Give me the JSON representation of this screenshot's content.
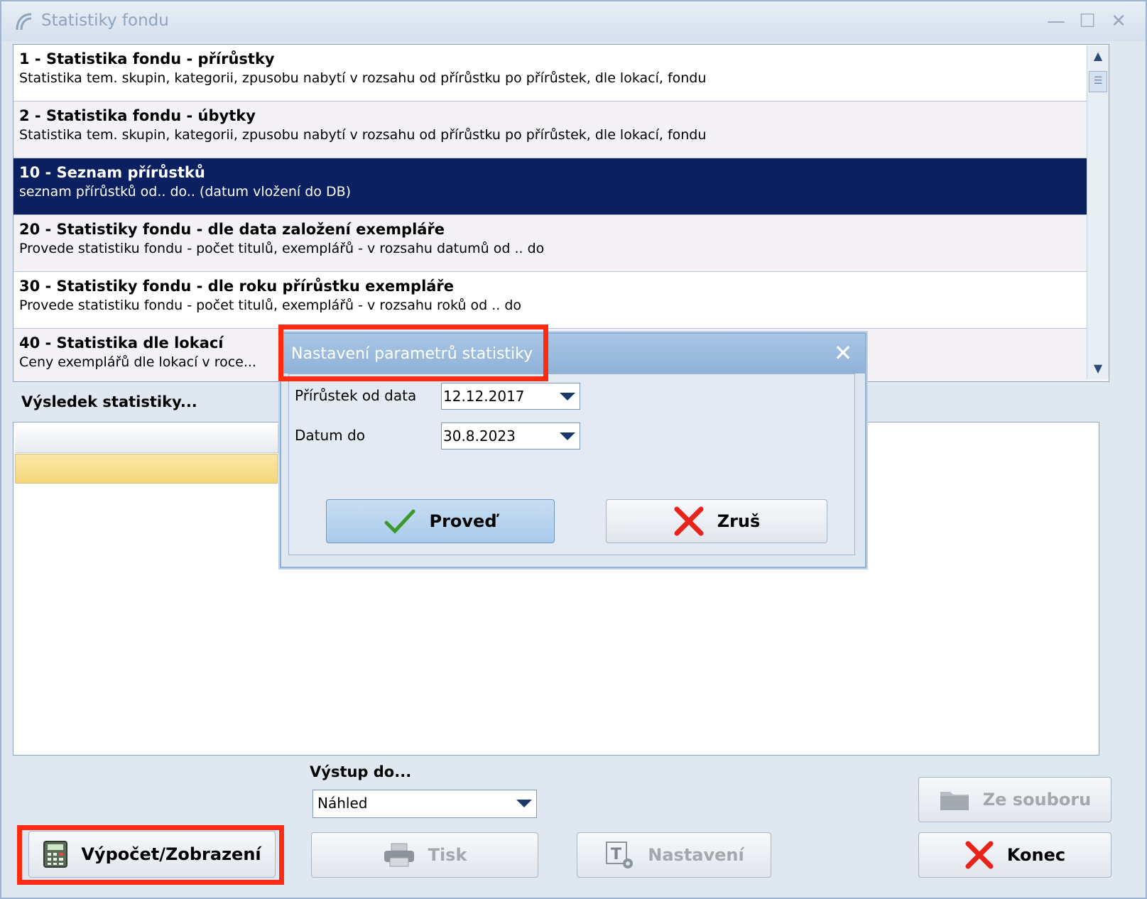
{
  "window": {
    "title": "Statistiky fondu"
  },
  "list": {
    "items": [
      {
        "title": "1 - Statistika fondu - přírůstky",
        "desc": "Statistika tem. skupin, kategorii, zpusobu nabytí v rozsahu  od přírůstku po přírůstek, dle lokací, fondu"
      },
      {
        "title": "2 - Statistika fondu - úbytky",
        "desc": "Statistika tem. skupin, kategorii, zpusobu nabytí v rozsahu  od přírůstku po přírůstek, dle lokací, fondu"
      },
      {
        "title": "10 - Seznam přírůstků",
        "desc": "seznam přírůstků od.. do.. (datum vložení do DB)"
      },
      {
        "title": "20 - Statistiky fondu - dle data založení exempláře",
        "desc": "Provede statistiku fondu - počet titulů, exemplářů - v rozsahu datumů od .. do"
      },
      {
        "title": "30 - Statistiky fondu - dle roku přírůstku exempláře",
        "desc": "Provede statistiku fondu - počet titulů, exemplářů - v rozsahu roků od .. do"
      },
      {
        "title": "40 - Statistika  dle lokací",
        "desc": "Ceny exemplářů dle lokací v roce..."
      }
    ],
    "selected_index": 2
  },
  "result": {
    "label": "Výsledek statistiky..."
  },
  "output": {
    "label": "Výstup do...",
    "value": "Náhled"
  },
  "buttons": {
    "compute": "Výpočet/Zobrazení",
    "print": "Tisk",
    "settings": "Nastavení",
    "from_file": "Ze souboru",
    "close": "Konec"
  },
  "dialog": {
    "title": "Nastavení parametrů statistiky",
    "from_label": "Přírůstek od data",
    "from_value": "12.12.2017",
    "to_label": "Datum do",
    "to_value": "30.8.2023",
    "ok": "Proveď",
    "cancel": "Zruš"
  },
  "colors": {
    "selection": "#0a2060",
    "highlight": "#ff2a12",
    "grid_row": "#f4d67a"
  }
}
